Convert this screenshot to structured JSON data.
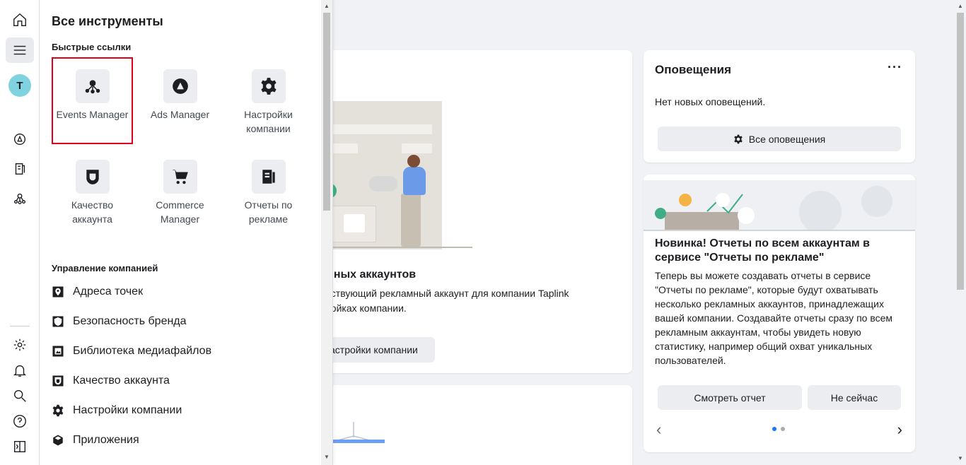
{
  "panel": {
    "title": "Все инструменты",
    "quick_links_title": "Быстрые ссылки",
    "quick_links": [
      {
        "label": "Events Manager",
        "icon": "events-manager-icon"
      },
      {
        "label": "Ads Manager",
        "icon": "ads-manager-icon"
      },
      {
        "label": "Настройки компании",
        "icon": "gear-icon"
      },
      {
        "label": "Качество аккаунта",
        "icon": "shield-icon"
      },
      {
        "label": "Commerce Manager",
        "icon": "cart-icon"
      },
      {
        "label": "Отчеты по рекламе",
        "icon": "reports-icon"
      }
    ],
    "manage_title": "Управление компанией",
    "manage_items": [
      {
        "label": "Адреса точек",
        "icon": "location-icon"
      },
      {
        "label": "Безопасность бренда",
        "icon": "shield-icon"
      },
      {
        "label": "Библиотека медиафайлов",
        "icon": "media-library-icon"
      },
      {
        "label": "Качество аккаунта",
        "icon": "badge-icon"
      },
      {
        "label": "Настройки компании",
        "icon": "gear-icon"
      },
      {
        "label": "Приложения",
        "icon": "cube-icon"
      }
    ]
  },
  "rail": {
    "avatar_letter": "T"
  },
  "main": {
    "card_title": "мных аккаунтов",
    "card_text_1": "ествующий рекламный аккаунт для компании Taplink",
    "card_text_2": "ройках компании.",
    "card_button": "астройки компании"
  },
  "notifications": {
    "title": "Оповещения",
    "more": "···",
    "empty_text": "Нет новых оповещений.",
    "all_button": "Все оповещения"
  },
  "promo": {
    "title": "Новинка! Отчеты по всем аккаунтам в сервисе \"Отчеты по рекламе\"",
    "text": "Теперь вы можете создавать отчеты в сервисе \"Отчеты по рекламе\", которые будут охватывать несколько рекламных аккаунтов, принадлежащих вашей компании. Создавайте отчеты сразу по всем рекламным аккаунтам, чтобы увидеть новую статистику, например общий охват уникальных пользователей.",
    "view_button": "Смотреть отчет",
    "later_button": "Не сейчас"
  },
  "colors": {
    "accent": "#1877f2",
    "highlight": "#e0001b",
    "avatar": "#7fd3e0"
  }
}
